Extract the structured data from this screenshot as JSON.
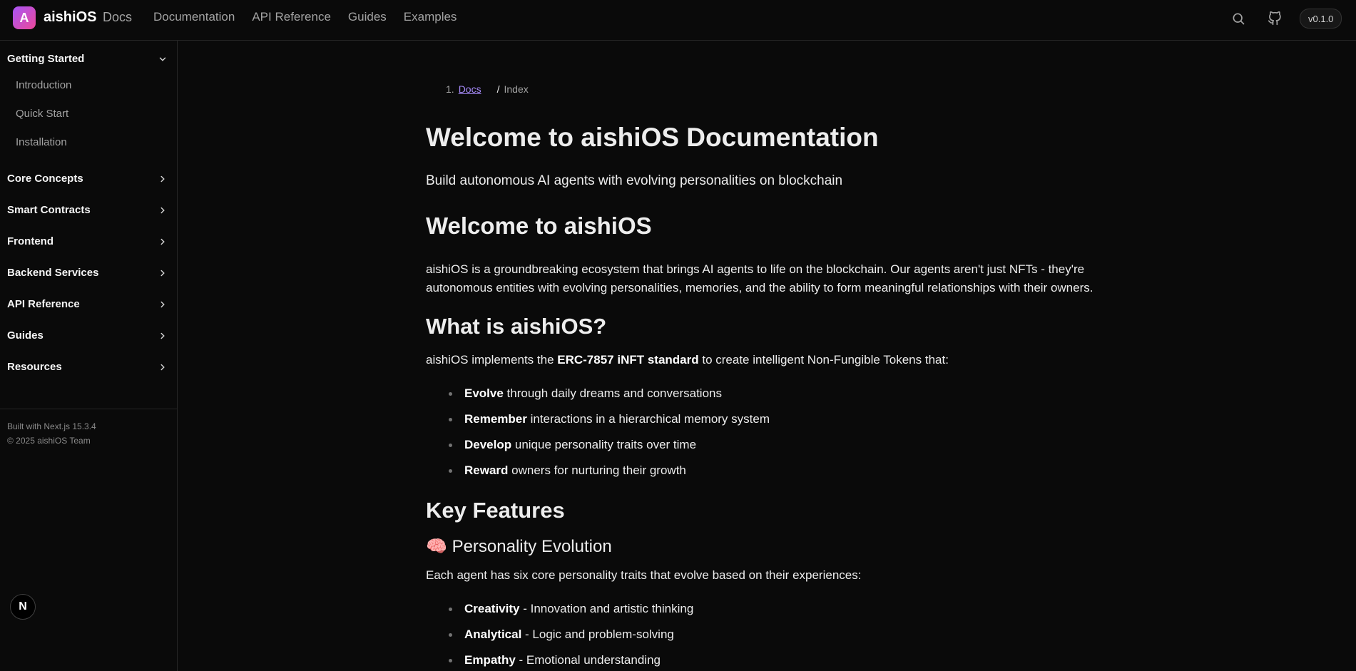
{
  "header": {
    "logo_letter": "A",
    "brand": "aishiOS",
    "brand_suffix": "Docs",
    "nav": [
      "Documentation",
      "API Reference",
      "Guides",
      "Examples"
    ],
    "version": "v0.1.0"
  },
  "sidebar": {
    "getting_started": "Getting Started",
    "getting_started_items": [
      "Introduction",
      "Quick Start",
      "Installation"
    ],
    "sections": [
      "Core Concepts",
      "Smart Contracts",
      "Frontend",
      "Backend Services",
      "API Reference",
      "Guides",
      "Resources"
    ],
    "footer_built": "Built with Next.js 15.3.4",
    "footer_copyright": "© 2025 aishiOS Team",
    "next_badge": "N"
  },
  "breadcrumb": {
    "num": "1.",
    "docs": "Docs",
    "sep": "/",
    "current": "Index"
  },
  "main": {
    "title": "Welcome to aishiOS Documentation",
    "subtitle": "Build autonomous AI agents with evolving personalities on blockchain",
    "h2_welcome": "Welcome to aishiOS",
    "intro_line1": "aishiOS is a groundbreaking ecosystem that brings AI agents to life on the blockchain. Our agents aren't just NFTs - they're",
    "intro_line2": "autonomous entities with evolving personalities, memories, and the ability to form meaningful relationships with their owners.",
    "h2_what": "What is aishiOS?",
    "what_pre": "aishiOS implements the ",
    "what_bold": "ERC-7857 iNFT standard",
    "what_post": " to create intelligent Non-Fungible Tokens that:",
    "what_items": [
      {
        "bold": "Evolve",
        "text": " through daily dreams and conversations"
      },
      {
        "bold": "Remember",
        "text": " interactions in a hierarchical memory system"
      },
      {
        "bold": "Develop",
        "text": " unique personality traits over time"
      },
      {
        "bold": "Reward",
        "text": " owners for nurturing their growth"
      }
    ],
    "h2_features": "Key Features",
    "h3_personality_icon": "🧠",
    "h3_personality": "Personality Evolution",
    "personality_intro": "Each agent has six core personality traits that evolve based on their experiences:",
    "traits": [
      {
        "bold": "Creativity",
        "text": " - Innovation and artistic thinking"
      },
      {
        "bold": "Analytical",
        "text": " - Logic and problem-solving"
      },
      {
        "bold": "Empathy",
        "text": " - Emotional understanding"
      }
    ]
  }
}
